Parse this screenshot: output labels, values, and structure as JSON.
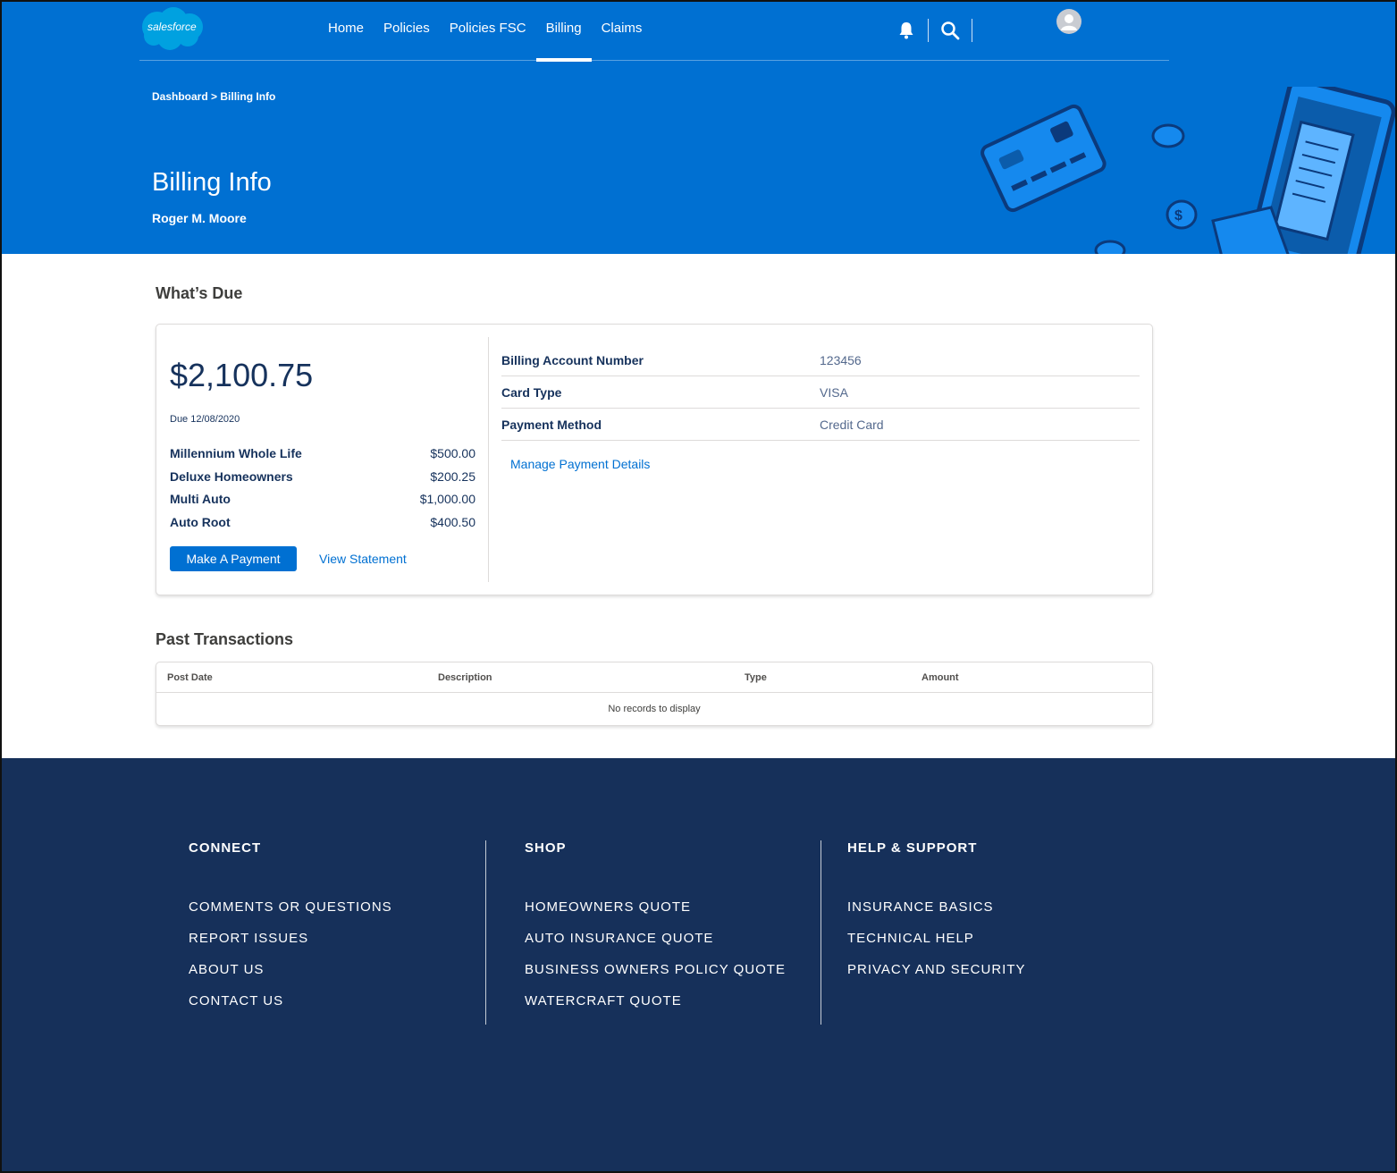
{
  "brand": {
    "logo_text": "salesforce"
  },
  "nav": {
    "items": [
      {
        "label": "Home"
      },
      {
        "label": "Policies"
      },
      {
        "label": "Policies FSC"
      },
      {
        "label": "Billing",
        "active": true
      },
      {
        "label": "Claims"
      }
    ]
  },
  "breadcrumb": {
    "root": "Dashboard",
    "separator": ">",
    "current": "Billing Info"
  },
  "header": {
    "title": "Billing Info",
    "subtitle": "Roger M. Moore"
  },
  "whats_due": {
    "title": "What’s Due",
    "amount": "$2,100.75",
    "due_date": "Due 12/08/2020",
    "items": [
      {
        "name": "Millennium Whole Life",
        "amount": "$500.00"
      },
      {
        "name": "Deluxe Homeowners",
        "amount": "$200.25"
      },
      {
        "name": "Multi Auto",
        "amount": "$1,000.00"
      },
      {
        "name": "Auto Root",
        "amount": "$400.50"
      }
    ],
    "pay_button": "Make A Payment",
    "statement_link": "View Statement",
    "details": [
      {
        "label": "Billing Account Number",
        "value": "123456"
      },
      {
        "label": "Card Type",
        "value": "VISA"
      },
      {
        "label": "Payment Method",
        "value": "Credit Card"
      }
    ],
    "manage_link": "Manage Payment Details"
  },
  "transactions": {
    "title": "Past Transactions",
    "columns": [
      "Post Date",
      "Description",
      "Type",
      "Amount"
    ],
    "empty_text": "No records to display"
  },
  "footer": {
    "columns": [
      {
        "heading": "CONNECT",
        "links": [
          "COMMENTS OR QUESTIONS",
          "REPORT ISSUES",
          "ABOUT US",
          "CONTACT US"
        ]
      },
      {
        "heading": "SHOP",
        "links": [
          "HOMEOWNERS QUOTE",
          "AUTO INSURANCE QUOTE",
          "BUSINESS OWNERS POLICY QUOTE",
          "WATERCRAFT QUOTE"
        ]
      },
      {
        "heading": "HELP & SUPPORT",
        "links": [
          "INSURANCE BASICS",
          "TECHNICAL HELP",
          "PRIVACY AND SECURITY"
        ]
      }
    ]
  },
  "colors": {
    "brand_blue": "#0070d2",
    "footer_navy": "#16305a",
    "text_navy": "#16325c"
  },
  "icons": [
    "salesforce-logo",
    "bell-icon",
    "search-icon",
    "user-avatar-icon"
  ]
}
